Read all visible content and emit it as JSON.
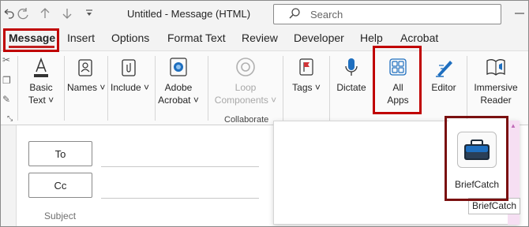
{
  "window": {
    "title": "Untitled  -  Message (HTML)",
    "search_placeholder": "Search"
  },
  "tabs": [
    {
      "label": "Message"
    },
    {
      "label": "Insert"
    },
    {
      "label": "Options"
    },
    {
      "label": "Format Text"
    },
    {
      "label": "Review"
    },
    {
      "label": "Developer"
    },
    {
      "label": "Help"
    },
    {
      "label": "Acrobat"
    }
  ],
  "ribbon": {
    "basic_text": {
      "line1": "Basic",
      "line2": "Text ˅"
    },
    "names": {
      "label": "Names ˅"
    },
    "include": {
      "label": "Include ˅"
    },
    "adobe_acrobat": {
      "line1": "Adobe",
      "line2": "Acrobat ˅"
    },
    "loop": {
      "line1": "Loop",
      "line2": "Components ˅"
    },
    "collaborate_group": "Collaborate",
    "tags": {
      "label": "Tags ˅"
    },
    "dictate": {
      "label": "Dictate"
    },
    "all_apps": {
      "line1": "All",
      "line2": "Apps"
    },
    "editor": {
      "label": "Editor"
    },
    "immersive_reader": {
      "line1": "Immersive",
      "line2": "Reader"
    }
  },
  "compose": {
    "to_label": "To",
    "cc_label": "Cc",
    "subject_label": "Subject"
  },
  "flyout": {
    "app_label": "BriefCatch",
    "tooltip": "BriefCatch"
  },
  "colors": {
    "highlight": "#c00000",
    "accent_blue": "#1f6fbf"
  }
}
